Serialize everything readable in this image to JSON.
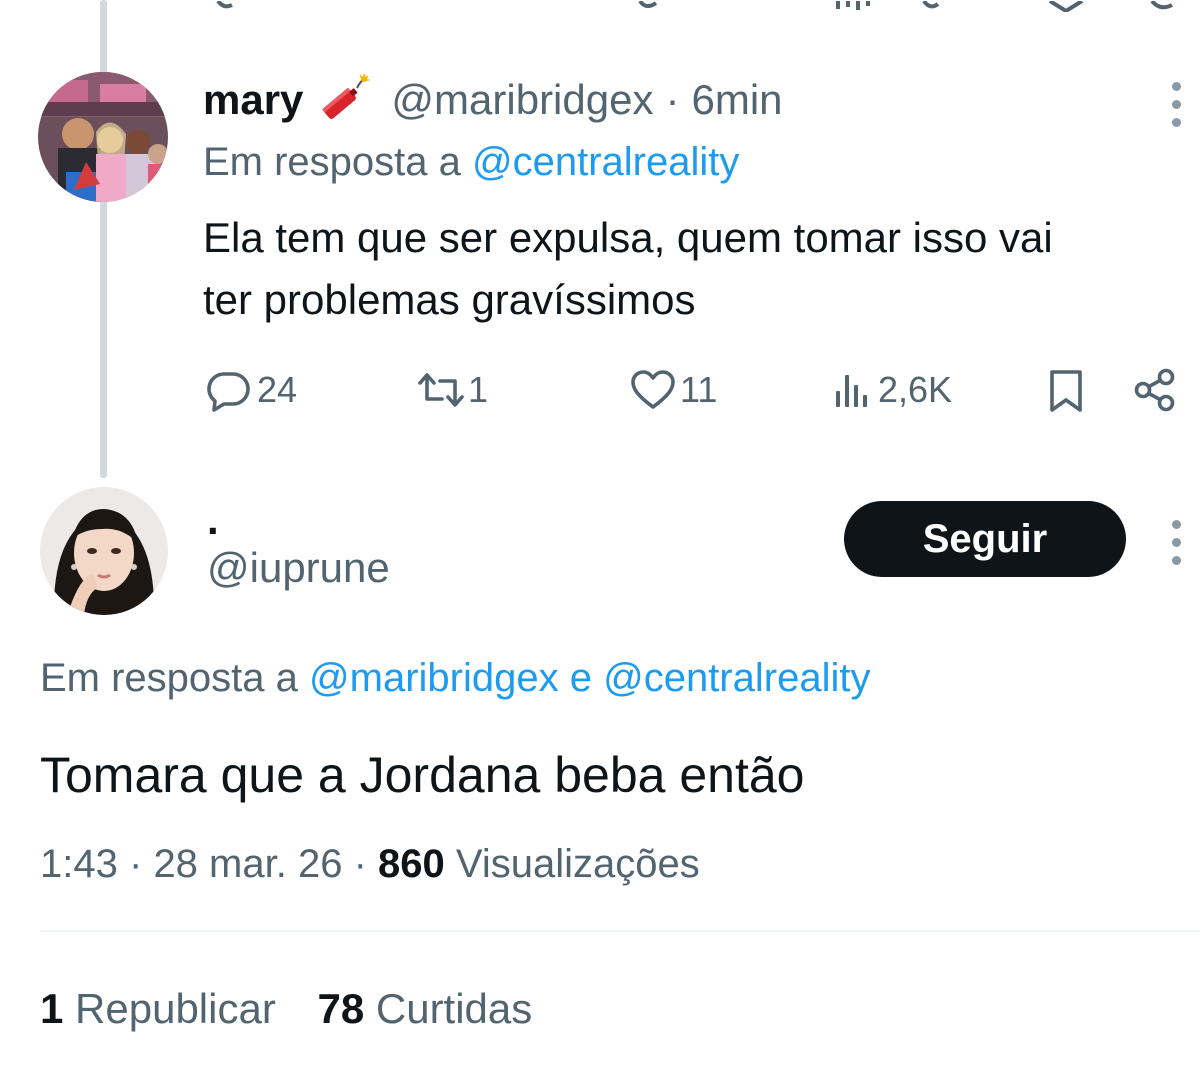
{
  "tweet1": {
    "display_name": "mary",
    "name_emoji": "🧨",
    "handle": "@maribridgex",
    "separator": "·",
    "time": "6min",
    "reply_prefix": "Em resposta a",
    "reply_to": "@centralreality",
    "text_line1": "Ela tem que ser expulsa, quem tomar isso vai",
    "text_line2": "ter problemas gravíssimos",
    "actions": {
      "replies": "24",
      "reposts": "1",
      "likes": "11",
      "views": "2,6K"
    },
    "icons": [
      "reply-icon",
      "repost-icon",
      "like-icon",
      "views-icon",
      "bookmark-icon",
      "share-icon",
      "more-icon"
    ]
  },
  "tweet2": {
    "display_name": ".",
    "handle": "@iuprune",
    "follow_label": "Seguir",
    "reply_prefix": "Em resposta a",
    "reply_to_1": "@maribridgex",
    "reply_conj": "e",
    "reply_to_2": "@centralreality",
    "text": "Tomara que a Jordana beba então",
    "time": "1:43",
    "dot1": "·",
    "date": "28 mar. 26",
    "dot2": "·",
    "views_count": "860",
    "views_label": "Visualizações",
    "reposts_count": "1",
    "reposts_label": "Republicar",
    "likes_count": "78",
    "likes_label": "Curtidas"
  },
  "colors": {
    "text": "#0f1419",
    "muted": "#536471",
    "link": "#1d9bf0",
    "thread_line": "#cfd9de",
    "button_bg": "#0f1419",
    "divider": "#eff3f4"
  }
}
